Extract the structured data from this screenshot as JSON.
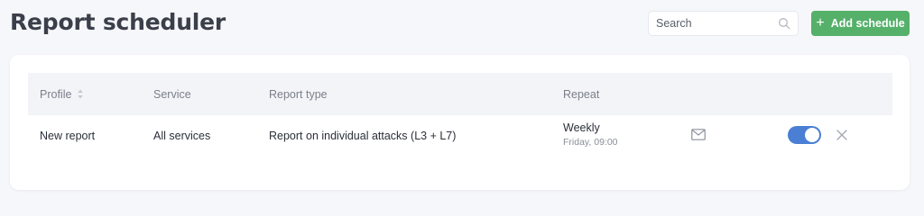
{
  "header": {
    "title": "Report scheduler",
    "search_placeholder": "Search",
    "add_button_label": "Add schedule"
  },
  "table": {
    "columns": [
      "Profile",
      "Service",
      "Report type",
      "Repeat"
    ],
    "rows": [
      {
        "profile": "New report",
        "service": "All services",
        "report_type": "Report on individual attacks (L3 + L7)",
        "repeat": "Weekly",
        "repeat_detail": "Friday, 09:00",
        "enabled": true
      }
    ]
  },
  "colors": {
    "accent_green": "#55b06a",
    "toggle_blue": "#4a7fd4"
  },
  "icons": [
    "search-icon",
    "plus-icon",
    "sort-icon",
    "mail-icon",
    "close-icon"
  ]
}
